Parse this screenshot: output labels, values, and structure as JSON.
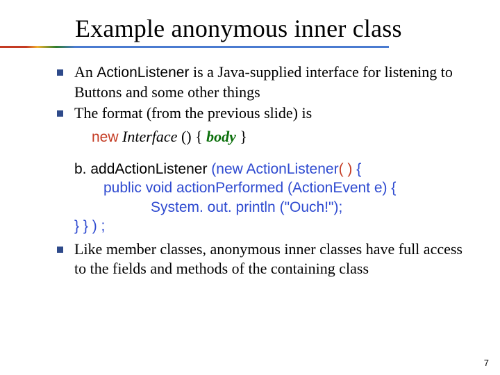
{
  "title": "Example anonymous inner class",
  "bullets": {
    "b1_pre": "An ",
    "b1_code": "ActionListener",
    "b1_post": " is a Java-supplied interface for listening to Buttons and some other things",
    "b2": "The format (from the previous slide) is",
    "b3": "Like member classes, anonymous inner classes have full access to the fields and methods of the containing class"
  },
  "format_line": {
    "new_kw": "new",
    "interface_kw": " Interface ",
    "parens": "() ",
    "brace_open": "{ ",
    "body_kw": "body",
    "brace_close": " }"
  },
  "code": {
    "l1a": "b. addActionListener ",
    "l1b": " (new ActionListener",
    "l1c": "( )",
    "l1d": " {",
    "l2": "public void actionPerformed (ActionEvent e) {",
    "l3": "System. out. println (\"Ouch!\");",
    "l4": "} } ) ;"
  },
  "page_number": "7"
}
